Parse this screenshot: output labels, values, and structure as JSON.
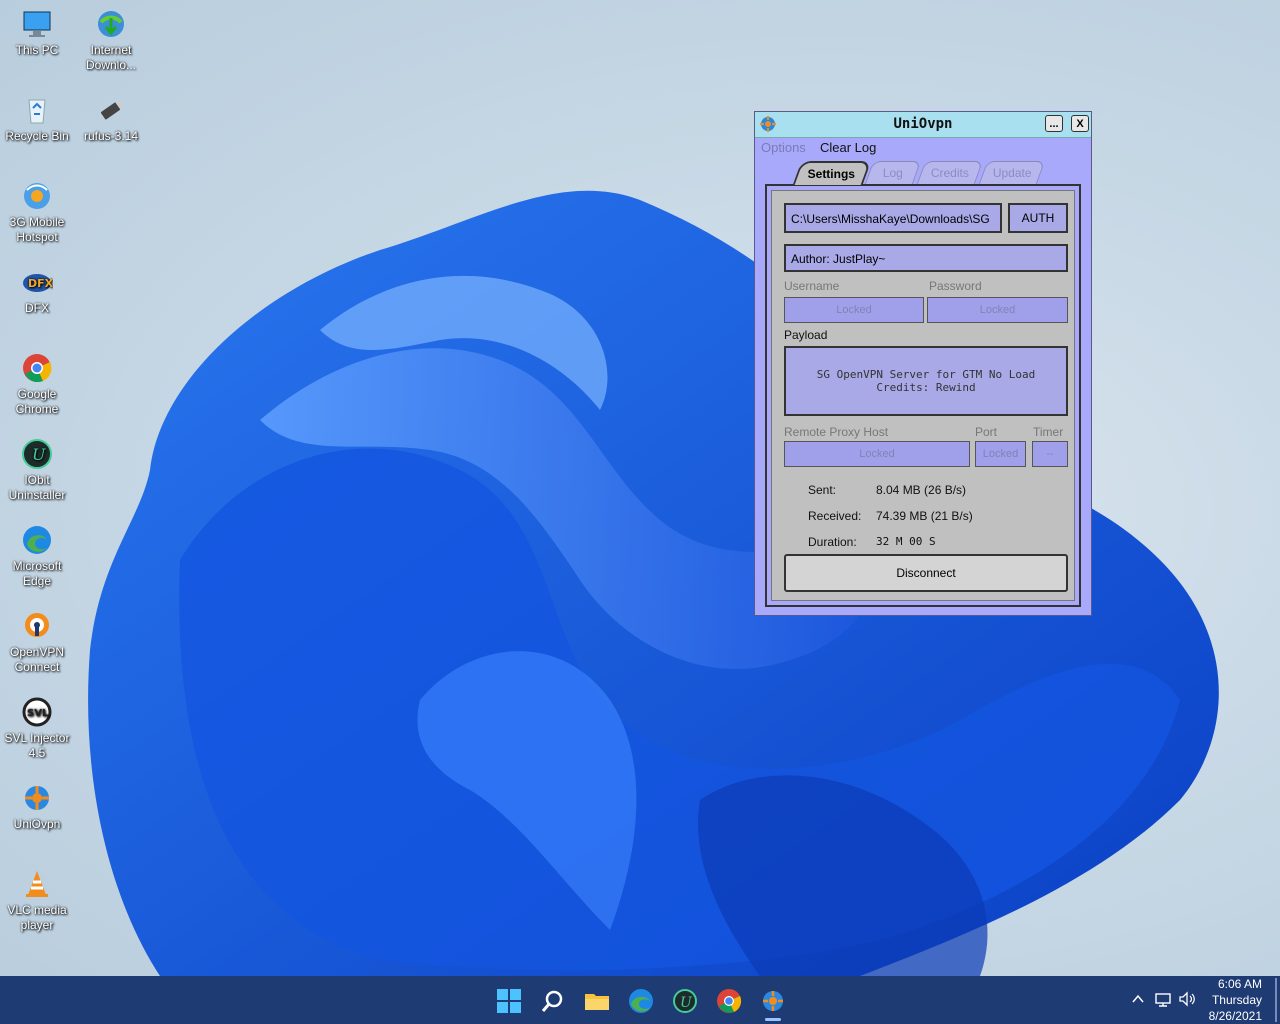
{
  "desktop": {
    "icons": [
      {
        "label": "This PC"
      },
      {
        "label": "Internet Downlo..."
      },
      {
        "label": "Recycle Bin"
      },
      {
        "label": "rufus-3.14"
      },
      {
        "label": "3G Mobile Hotspot"
      },
      {
        "label": "DFX"
      },
      {
        "label": "Google Chrome"
      },
      {
        "label": "IObit Uninstaller"
      },
      {
        "label": "Microsoft Edge"
      },
      {
        "label": "OpenVPN Connect"
      },
      {
        "label": "SVL Injector 4.5"
      },
      {
        "label": "UniOvpn"
      },
      {
        "label": "VLC media player"
      }
    ]
  },
  "window": {
    "title": "UniOvpn",
    "minimize_label": "...",
    "close_label": "X",
    "menu": {
      "options": "Options",
      "clear_log": "Clear Log"
    },
    "tabs": [
      {
        "label": "Settings"
      },
      {
        "label": "Log"
      },
      {
        "label": "Credits"
      },
      {
        "label": "Update"
      }
    ],
    "config_path": "C:\\Users\\MisshaKaye\\Downloads\\SG",
    "auth_label": "AUTH",
    "author": "Author: JustPlay~",
    "username_label": "Username",
    "password_label": "Password",
    "username_value": "Locked",
    "password_value": "Locked",
    "payload_label": "Payload",
    "payload_line1": "SG OpenVPN Server for GTM No Load",
    "payload_line2": "Credits: Rewind",
    "proxy_host_label": "Remote Proxy Host",
    "port_label": "Port",
    "timer_label": "Timer",
    "proxy_host_value": "Locked",
    "port_value": "Locked",
    "timer_value": "--",
    "sent_label": "Sent:",
    "sent_value": "8.04 MB (26 B/s)",
    "received_label": "Received:",
    "received_value": "74.39 MB (21 B/s)",
    "duration_label": "Duration:",
    "duration_value": "32 M 00 S",
    "disconnect_label": "Disconnect"
  },
  "taskbar": {
    "time": "6:06 AM",
    "day": "Thursday",
    "date": "8/26/2021"
  }
}
